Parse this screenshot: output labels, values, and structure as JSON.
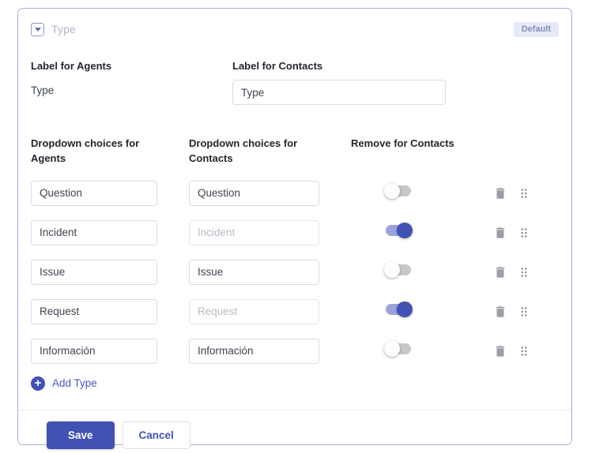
{
  "card": {
    "title": "Type",
    "badge": "Default"
  },
  "labels": {
    "agents_heading": "Label for Agents",
    "agents_value": "Type",
    "contacts_heading": "Label for Contacts",
    "contacts_value": "Type"
  },
  "choices": {
    "agents_header": "Dropdown choices for Agents",
    "contacts_header": "Dropdown choices for Contacts",
    "remove_header": "Remove for Contacts",
    "rows": [
      {
        "agent": "Question",
        "contact": "Question",
        "contact_disabled": false,
        "removed": false
      },
      {
        "agent": "Incident",
        "contact": "Incident",
        "contact_disabled": true,
        "removed": true
      },
      {
        "agent": "Issue",
        "contact": "Issue",
        "contact_disabled": false,
        "removed": false
      },
      {
        "agent": "Request",
        "contact": "Request",
        "contact_disabled": true,
        "removed": true
      },
      {
        "agent": "Información",
        "contact": "Información",
        "contact_disabled": false,
        "removed": false
      }
    ]
  },
  "actions": {
    "add_label": "Add Type",
    "save_label": "Save",
    "cancel_label": "Cancel"
  },
  "icons": {
    "header": "dropdown-field-type-icon",
    "row": [
      "trash-icon",
      "drag-handle-icon"
    ],
    "add": "plus-icon"
  },
  "colors": {
    "primary": "#4152b3",
    "link": "#4a57c8",
    "track-on": "#9aa3de",
    "track-off": "#b4b4b4",
    "card-border": "#a9b0e0",
    "badge-bg": "#e6e9f7",
    "badge-text": "#8590bb"
  }
}
